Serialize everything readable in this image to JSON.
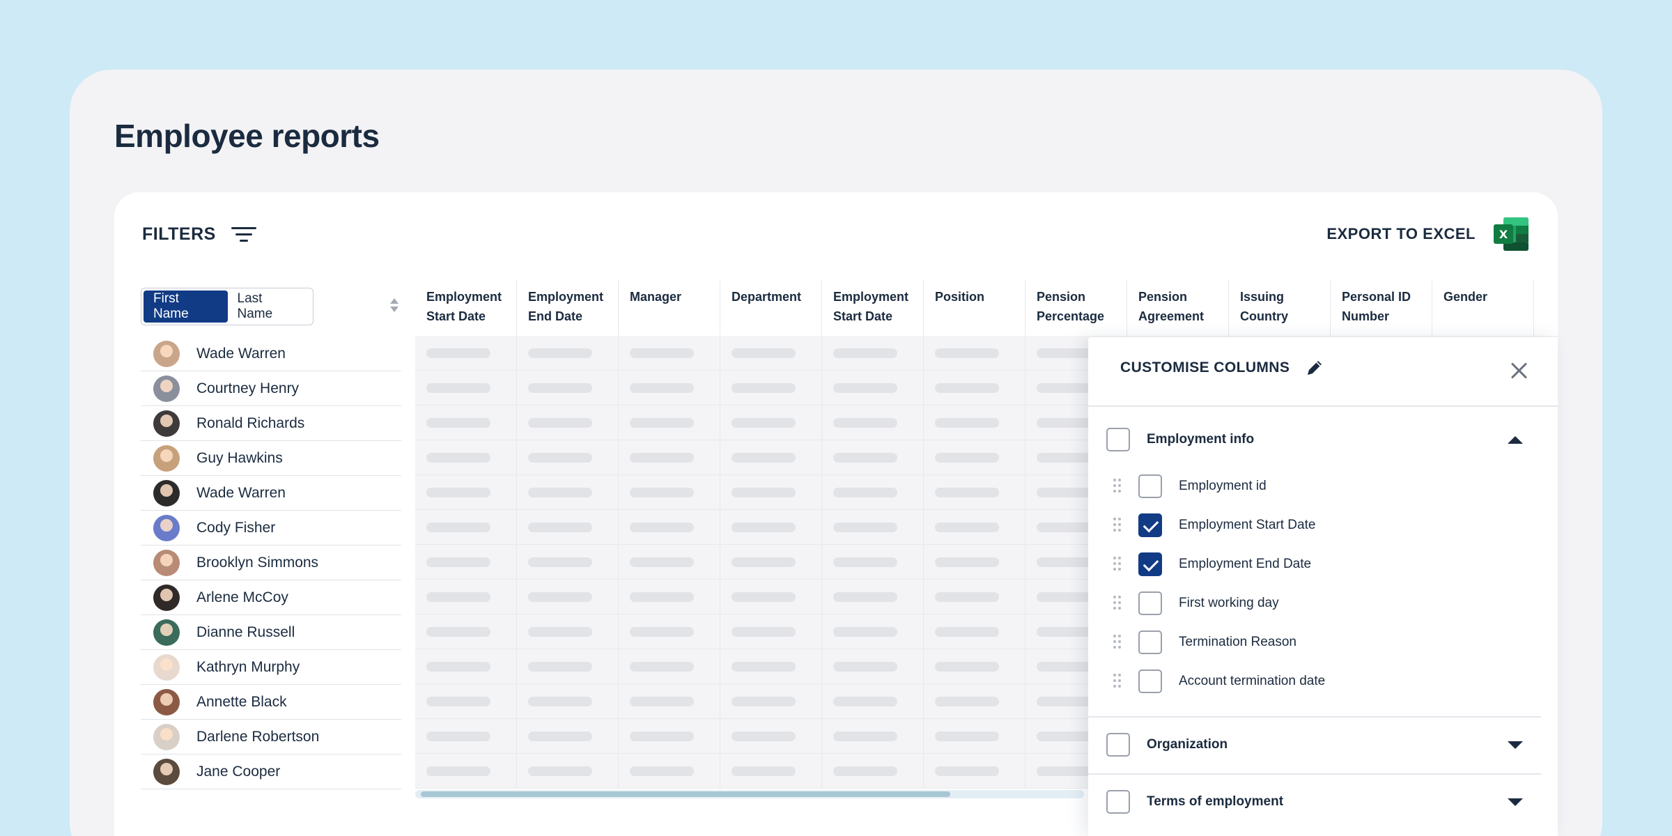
{
  "page": {
    "title": "Employee reports"
  },
  "toolbar": {
    "filters_label": "FILTERS",
    "filter_icon": "filter-lines-icon",
    "export_label": "EXPORT TO EXCEL",
    "export_icon": "excel-icon",
    "excel_green": "#1f7a45"
  },
  "name_sort": {
    "options": [
      "First Name",
      "Last Name"
    ],
    "active": "First Name",
    "accent": "#123b85"
  },
  "employees": [
    {
      "name": "Wade Warren",
      "avatar_color": "#c9a58a"
    },
    {
      "name": "Courtney Henry",
      "avatar_color": "#8a8f9c"
    },
    {
      "name": "Ronald Richards",
      "avatar_color": "#3f3a3a"
    },
    {
      "name": "Guy Hawkins",
      "avatar_color": "#c7a07c"
    },
    {
      "name": "Wade Warren",
      "avatar_color": "#2d2a2a"
    },
    {
      "name": "Cody Fisher",
      "avatar_color": "#6a7cc9"
    },
    {
      "name": "Brooklyn Simmons",
      "avatar_color": "#b88b76"
    },
    {
      "name": "Arlene McCoy",
      "avatar_color": "#2f2a28"
    },
    {
      "name": "Dianne Russell",
      "avatar_color": "#3b6b5a"
    },
    {
      "name": "Kathryn Murphy",
      "avatar_color": "#e8d9cf"
    },
    {
      "name": "Annette Black",
      "avatar_color": "#8c5a44"
    },
    {
      "name": "Darlene Robertson",
      "avatar_color": "#d8cfc6"
    },
    {
      "name": "Jane Cooper",
      "avatar_color": "#5b4a3e"
    }
  ],
  "grid": {
    "columns": [
      [
        "Employment",
        "Start Date"
      ],
      [
        "Employment",
        "End Date"
      ],
      [
        "Manager",
        ""
      ],
      [
        "Department",
        ""
      ],
      [
        "Employment",
        "Start Date"
      ],
      [
        "Position",
        ""
      ],
      [
        "Pension",
        "Percentage"
      ],
      [
        "Pension",
        "Agreement"
      ],
      [
        "Issuing",
        "Country"
      ],
      [
        "Personal ID",
        "Number"
      ],
      [
        "Gender",
        ""
      ]
    ],
    "row_count": 13
  },
  "panel": {
    "title": "CUSTOMISE COLUMNS",
    "edit_icon": "pencil-icon",
    "close_icon": "close-icon",
    "sections": [
      {
        "label": "Employment info",
        "checked": false,
        "expanded": true,
        "options": [
          {
            "label": "Employment id",
            "checked": false
          },
          {
            "label": "Employment Start Date",
            "checked": true
          },
          {
            "label": "Employment End Date",
            "checked": true
          },
          {
            "label": "First working day",
            "checked": false
          },
          {
            "label": "Termination Reason",
            "checked": false
          },
          {
            "label": "Account termination date",
            "checked": false
          }
        ]
      },
      {
        "label": "Organization",
        "checked": false,
        "expanded": false,
        "options": []
      },
      {
        "label": "Terms of employment",
        "checked": false,
        "expanded": false,
        "options": []
      }
    ]
  }
}
